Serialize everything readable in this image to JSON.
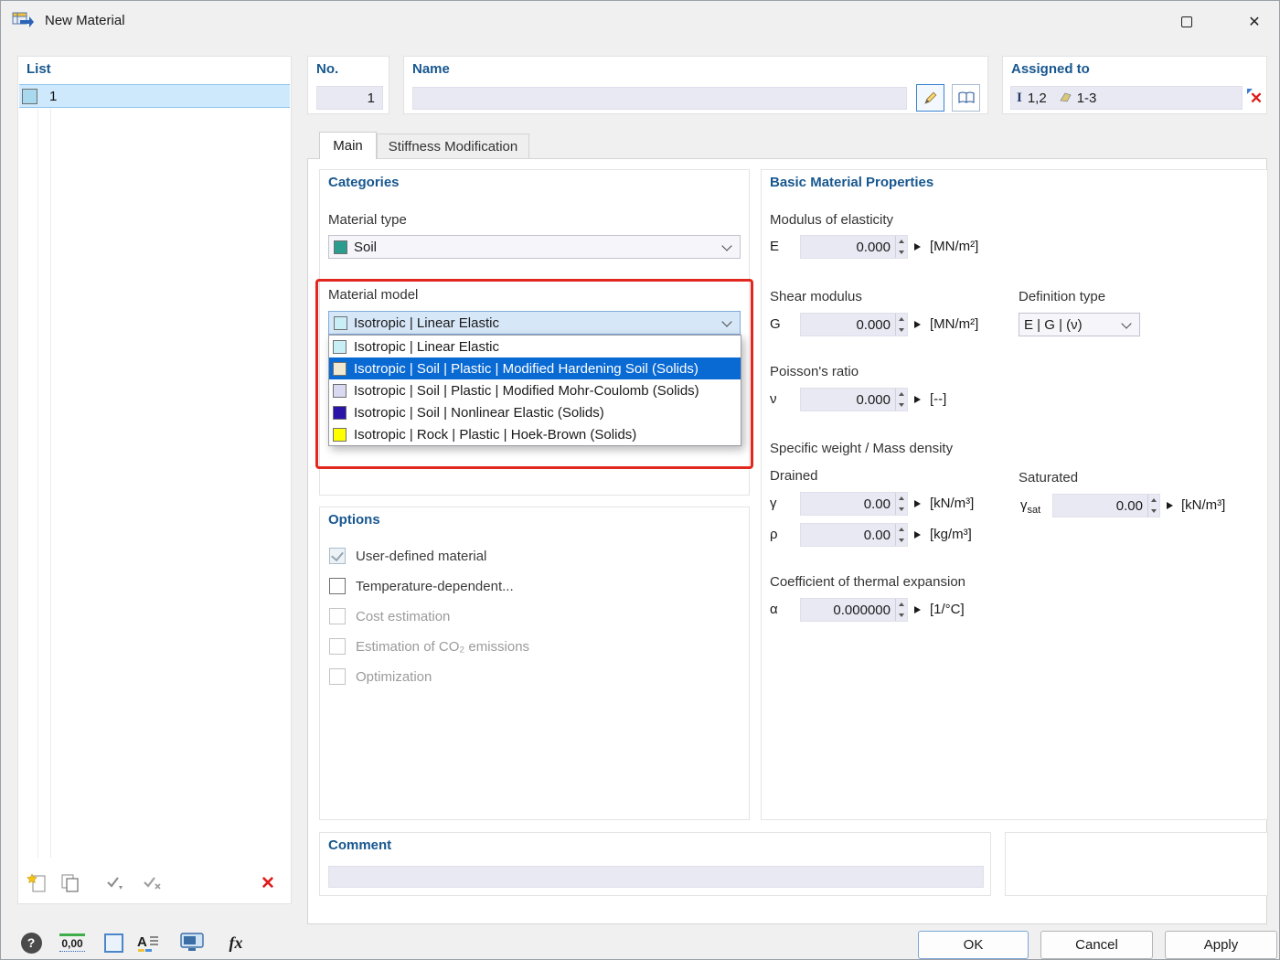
{
  "window": {
    "title": "New Material"
  },
  "icons": {
    "close": "✕",
    "help": "?",
    "units": "0,00",
    "fx": "fx",
    "delete": "✕",
    "assigned_clear": "✕"
  },
  "list": {
    "header": "List",
    "rows": [
      {
        "number": "1",
        "swatch": "#a9d9ef"
      }
    ]
  },
  "header_fields": {
    "no": {
      "label": "No.",
      "value": "1"
    },
    "name": {
      "label": "Name",
      "value": ""
    },
    "assigned": {
      "label": "Assigned to",
      "solids": "1,2",
      "surfaces": "1-3"
    }
  },
  "tabs": [
    {
      "label": "Main"
    },
    {
      "label": "Stiffness Modification"
    }
  ],
  "categories": {
    "header": "Categories",
    "material_type": {
      "label": "Material type",
      "value": "Soil",
      "swatch": "#2a9d8f"
    },
    "material_model": {
      "label": "Material model",
      "value": "Isotropic | Linear Elastic",
      "swatch": "#c8eff6",
      "options": [
        {
          "label": "Isotropic | Linear Elastic",
          "swatch": "#c8eff6",
          "selected": false
        },
        {
          "label": "Isotropic | Soil | Plastic | Modified Hardening Soil (Solids)",
          "swatch": "#f0e8d0",
          "selected": true
        },
        {
          "label": "Isotropic | Soil | Plastic | Modified Mohr-Coulomb (Solids)",
          "swatch": "#d9d9f2",
          "selected": false
        },
        {
          "label": "Isotropic | Soil | Nonlinear Elastic (Solids)",
          "swatch": "#2a14a8",
          "selected": false
        },
        {
          "label": "Isotropic | Rock | Plastic | Hoek-Brown (Solids)",
          "swatch": "#ffff00",
          "selected": false
        }
      ]
    }
  },
  "options": {
    "header": "Options",
    "items": [
      {
        "label": "User-defined material",
        "checked": true,
        "enabled": false
      },
      {
        "label": "Temperature-dependent...",
        "checked": false,
        "enabled": true
      },
      {
        "label": "Cost estimation",
        "checked": false,
        "enabled": false
      },
      {
        "label": "Estimation of CO₂ emissions",
        "checked": false,
        "enabled": false
      },
      {
        "label": "Optimization",
        "checked": false,
        "enabled": false
      }
    ]
  },
  "properties": {
    "header": "Basic Material Properties",
    "modulus_group": "Modulus of elasticity",
    "e": {
      "symbol": "E",
      "value": "0.000",
      "unit": "[MN/m²]"
    },
    "shear_group": "Shear modulus",
    "g": {
      "symbol": "G",
      "value": "0.000",
      "unit": "[MN/m²]"
    },
    "definition": {
      "label": "Definition type",
      "value": "E | G | (ν)"
    },
    "poisson_group": "Poisson's ratio",
    "nu": {
      "symbol": "ν",
      "value": "0.000",
      "unit": "[--]"
    },
    "weight_group": "Specific weight / Mass density",
    "drained_label": "Drained",
    "saturated_label": "Saturated",
    "gamma": {
      "symbol": "γ",
      "value": "0.00",
      "unit": "[kN/m³]"
    },
    "rho": {
      "symbol": "ρ",
      "value": "0.00",
      "unit": "[kg/m³]"
    },
    "gamma_sat": {
      "symbol": "γ",
      "symbol_sub": "sat",
      "value": "0.00",
      "unit": "[kN/m³]"
    },
    "thermal_group": "Coefficient of thermal expansion",
    "alpha": {
      "symbol": "α",
      "value": "0.000000",
      "unit": "[1/°C]"
    }
  },
  "comment": {
    "header": "Comment",
    "value": ""
  },
  "footer": {
    "ok": "OK",
    "cancel": "Cancel",
    "apply": "Apply"
  }
}
